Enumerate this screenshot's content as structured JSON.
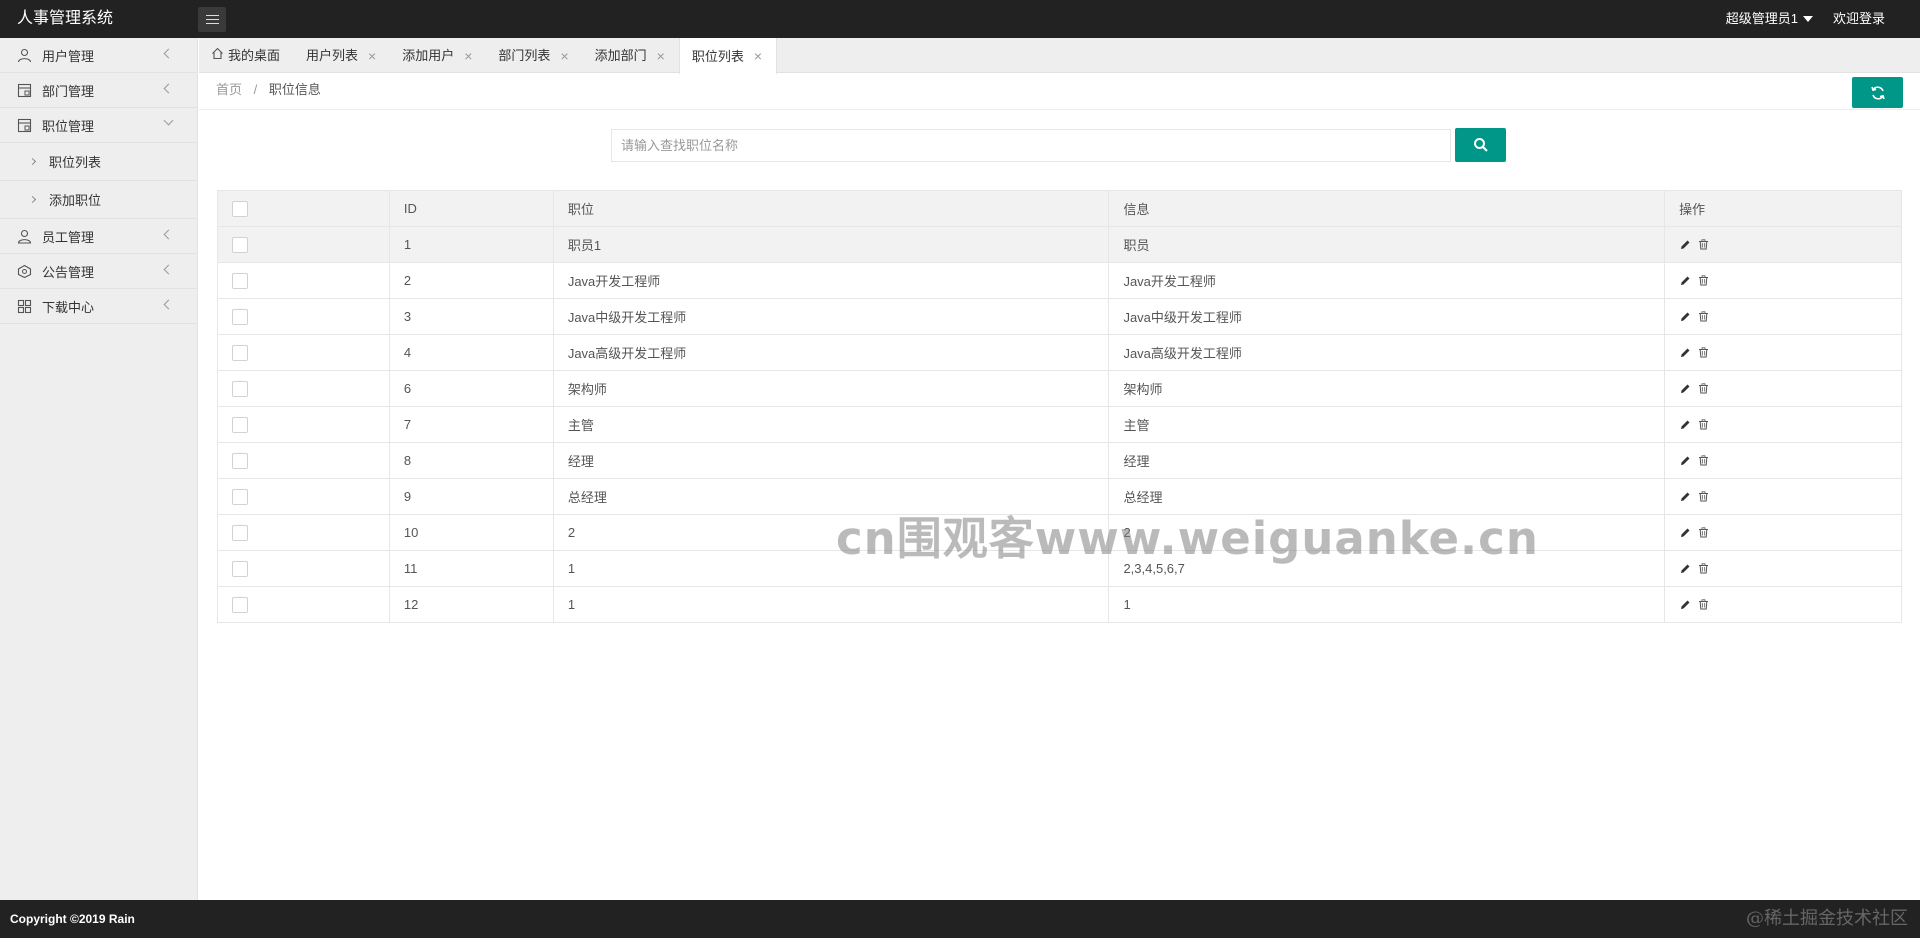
{
  "header": {
    "title": "人事管理系统",
    "user_menu": "超级管理员1",
    "welcome": "欢迎登录"
  },
  "sidebar": {
    "items": [
      {
        "label": "用户管理",
        "icon": "user-icon"
      },
      {
        "label": "部门管理",
        "icon": "department-icon"
      },
      {
        "label": "职位管理",
        "icon": "position-icon"
      },
      {
        "label": "员工管理",
        "icon": "employee-icon"
      },
      {
        "label": "公告管理",
        "icon": "notice-icon"
      },
      {
        "label": "下载中心",
        "icon": "download-icon"
      }
    ],
    "sub_items": [
      {
        "label": "职位列表"
      },
      {
        "label": "添加职位"
      }
    ]
  },
  "tabs": [
    {
      "label": "我的桌面"
    },
    {
      "label": "用户列表"
    },
    {
      "label": "添加用户"
    },
    {
      "label": "部门列表"
    },
    {
      "label": "添加部门"
    },
    {
      "label": "职位列表"
    }
  ],
  "breadcrumb": {
    "home": "首页",
    "separator": "/",
    "current": "职位信息"
  },
  "search": {
    "placeholder": "请输入查找职位名称",
    "value": ""
  },
  "table": {
    "headers": [
      "ID",
      "职位",
      "信息",
      "操作"
    ],
    "rows": [
      {
        "id": "1",
        "name": "职员1",
        "info": "职员"
      },
      {
        "id": "2",
        "name": "Java开发工程师",
        "info": "Java开发工程师"
      },
      {
        "id": "3",
        "name": "Java中级开发工程师",
        "info": "Java中级开发工程师"
      },
      {
        "id": "4",
        "name": "Java高级开发工程师",
        "info": "Java高级开发工程师"
      },
      {
        "id": "6",
        "name": "架构师",
        "info": "架构师"
      },
      {
        "id": "7",
        "name": "主管",
        "info": "主管"
      },
      {
        "id": "8",
        "name": "经理",
        "info": "经理"
      },
      {
        "id": "9",
        "name": "总经理",
        "info": "总经理"
      },
      {
        "id": "10",
        "name": "2",
        "info": "2"
      },
      {
        "id": "11",
        "name": "1",
        "info": "2,3,4,5,6,7"
      },
      {
        "id": "12",
        "name": "1",
        "info": "1"
      }
    ]
  },
  "watermark": "cn围观客www.weiguanke.cn",
  "footer": {
    "copyright": "Copyright ©2019 Rain",
    "juejin": "@稀土掘金技术社区"
  },
  "colors": {
    "primary": "#009688",
    "header_bg": "#222222",
    "sidebar_bg": "#eeeeee"
  }
}
